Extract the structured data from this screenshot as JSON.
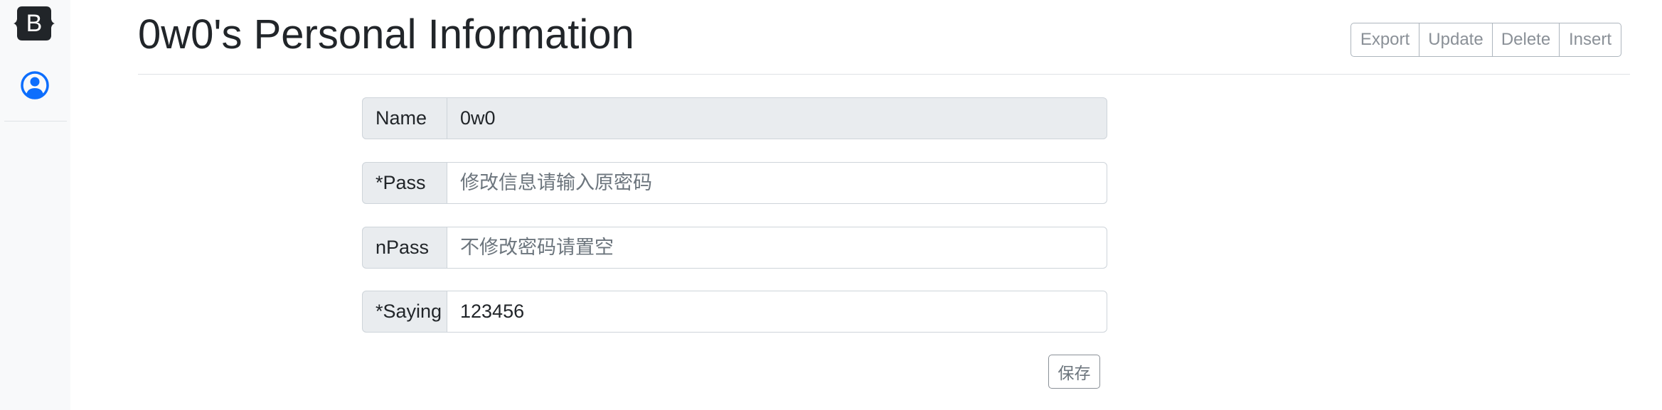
{
  "sidebar": {
    "brand_letter": "B",
    "brand_color": "#212529",
    "profile_icon": "person-circle-icon",
    "profile_icon_color": "#0d6efd"
  },
  "header": {
    "title": "0w0's Personal Information",
    "actions": [
      "Export",
      "Update",
      "Delete",
      "Insert"
    ]
  },
  "form": {
    "name": {
      "label": "Name",
      "value": "0w0"
    },
    "pass": {
      "label": "*Pass",
      "value": "",
      "placeholder": "修改信息请输入原密码"
    },
    "npass": {
      "label": "nPass",
      "value": "",
      "placeholder": "不修改密码请置空"
    },
    "saying": {
      "label": "*Saying",
      "value": "123456"
    },
    "save_label": "保存"
  }
}
